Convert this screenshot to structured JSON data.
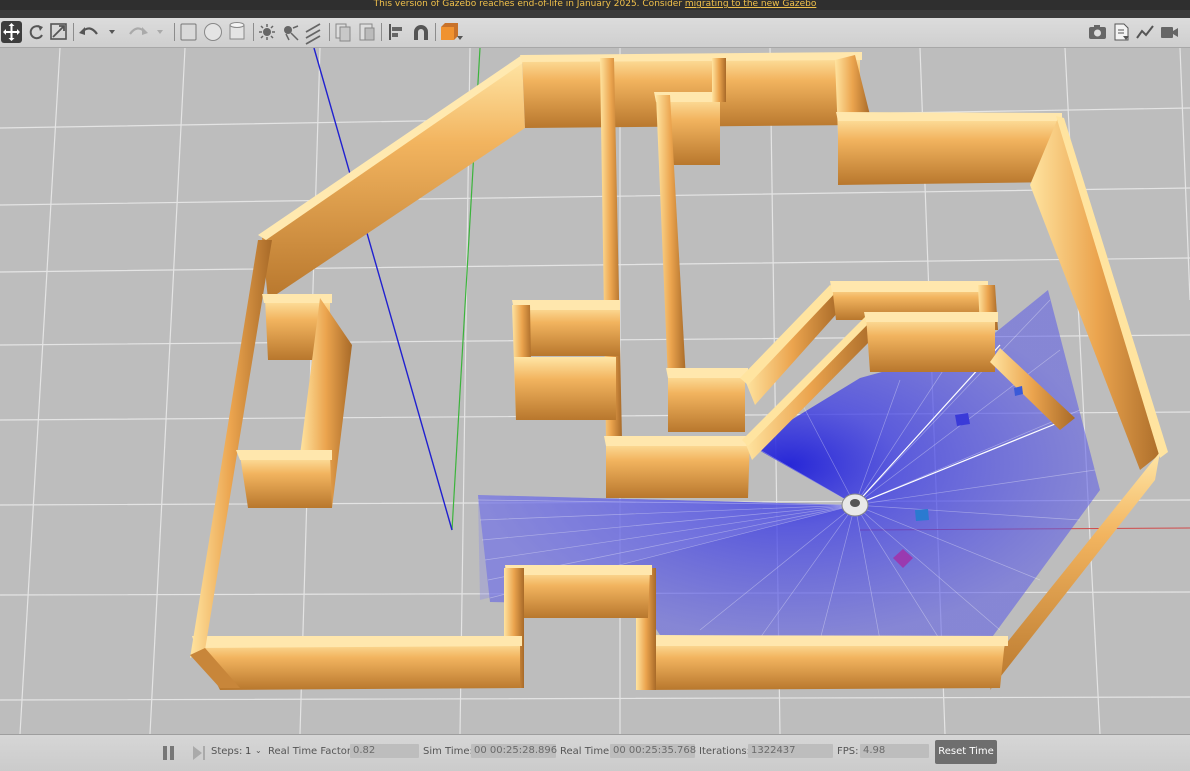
{
  "banner": {
    "text": "This version of Gazebo reaches end-of-life in January 2025. Consider ",
    "link": "migrating to the new Gazebo"
  },
  "toolbar": {
    "left_icons": [
      "move-icon",
      "rotate-icon",
      "scale-icon",
      "undo-icon",
      "undo-dropdown-icon",
      "redo-icon",
      "redo-dropdown-icon",
      "box-icon",
      "sphere-icon",
      "cylinder-icon",
      "point-light-icon",
      "spot-light-icon",
      "directional-light-icon",
      "copy-icon",
      "paste-icon",
      "align-icon",
      "snap-icon",
      "view-angle-icon"
    ],
    "right_icons": [
      "screenshot-icon",
      "log-icon",
      "plot-icon",
      "record-icon"
    ],
    "accent_color": "#f0922f"
  },
  "viewport": {
    "ground_color": "#bdbdbd",
    "grid_color": "#e6e6e6",
    "wall_color": "#e3a452",
    "laser_color": "#3a3ae6"
  },
  "bottom": {
    "steps_label": "Steps:",
    "steps_value": "1",
    "rtf_label": "Real Time Factor:",
    "rtf_value": "0.82",
    "sim_label": "Sim Time:",
    "sim_value": "00 00:25:28.896",
    "real_label": "Real Time:",
    "real_value": "00 00:25:35.768",
    "iter_label": "Iterations:",
    "iter_value": "1322437",
    "fps_label": "FPS:",
    "fps_value": "4.98",
    "reset_label": "Reset Time"
  }
}
